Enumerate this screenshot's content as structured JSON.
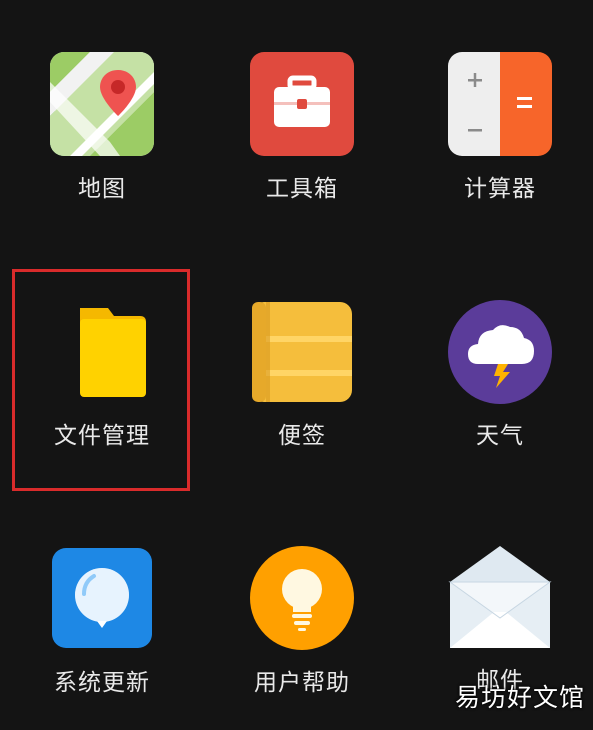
{
  "apps": {
    "maps": {
      "label": "地图",
      "icon": "map-pin-icon"
    },
    "toolbox": {
      "label": "工具箱",
      "icon": "toolbox-icon"
    },
    "calculator": {
      "label": "计算器",
      "icon": "calculator-icon"
    },
    "file_manager": {
      "label": "文件管理",
      "icon": "folder-icon"
    },
    "notes": {
      "label": "便签",
      "icon": "notes-icon"
    },
    "weather": {
      "label": "天气",
      "icon": "storm-cloud-icon"
    },
    "system_update": {
      "label": "系统更新",
      "icon": "balloon-icon"
    },
    "user_help": {
      "label": "用户帮助",
      "icon": "light-bulb-icon"
    },
    "mail": {
      "label": "邮件",
      "icon": "envelope-icon"
    }
  },
  "highlight": {
    "color": "#d92b2b",
    "target": "file_manager"
  },
  "watermark": {
    "text": "易坊好文馆"
  },
  "colors": {
    "background": "#141414",
    "toolbox_red": "#e04a3e",
    "calculator_orange": "#f7652a",
    "folder_yellow": "#ffd200",
    "notes_yellow": "#f5be3c",
    "weather_purple": "#5b3c9a",
    "update_blue": "#1e88e5",
    "help_orange": "#ffa000"
  }
}
